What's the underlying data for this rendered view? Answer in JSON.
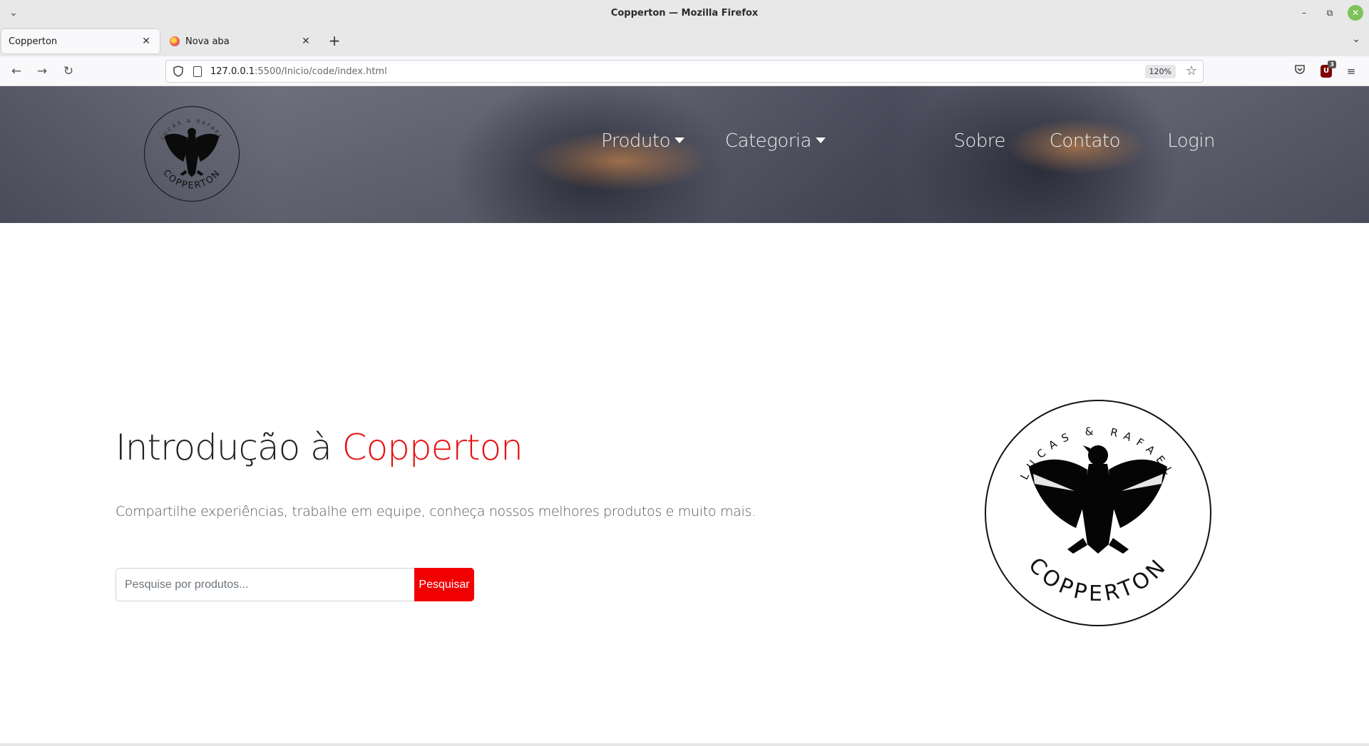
{
  "window": {
    "title": "Copperton — Mozilla Firefox"
  },
  "tabs": [
    {
      "label": "Copperton",
      "active": true
    },
    {
      "label": "Nova aba",
      "active": false
    }
  ],
  "toolbar": {
    "url_host": "127.0.0.1",
    "url_path": ":5500/Inicio/code/index.html",
    "zoom": "120%",
    "ublock_count": "3"
  },
  "site": {
    "nav": {
      "produto": "Produto",
      "categoria": "Categoria",
      "sobre": "Sobre",
      "contato": "Contato",
      "login": "Login"
    },
    "intro": {
      "title_prefix": "Introdução à ",
      "title_brand": "Copperton",
      "subtitle": "Compartilhe experiências, trabalhe em equipe, conheça nossos melhores produtos e muito mais."
    },
    "search": {
      "placeholder": "Pesquise por produtos...",
      "button": "Pesquisar"
    },
    "logo": {
      "top_text": "LUCAS & RAFAEL",
      "bottom_text": "COPPERTON"
    }
  },
  "colors": {
    "accent_red": "#f00000",
    "title_red": "#e81010"
  },
  "icons": [
    "list-all-tabs-icon",
    "minimize-icon",
    "restore-icon",
    "close-icon",
    "back-arrow-icon",
    "forward-arrow-icon",
    "reload-icon",
    "shield-icon",
    "page-icon",
    "star-icon",
    "pocket-icon",
    "ublock-icon",
    "hamburger-menu-icon",
    "eagle-icon"
  ]
}
